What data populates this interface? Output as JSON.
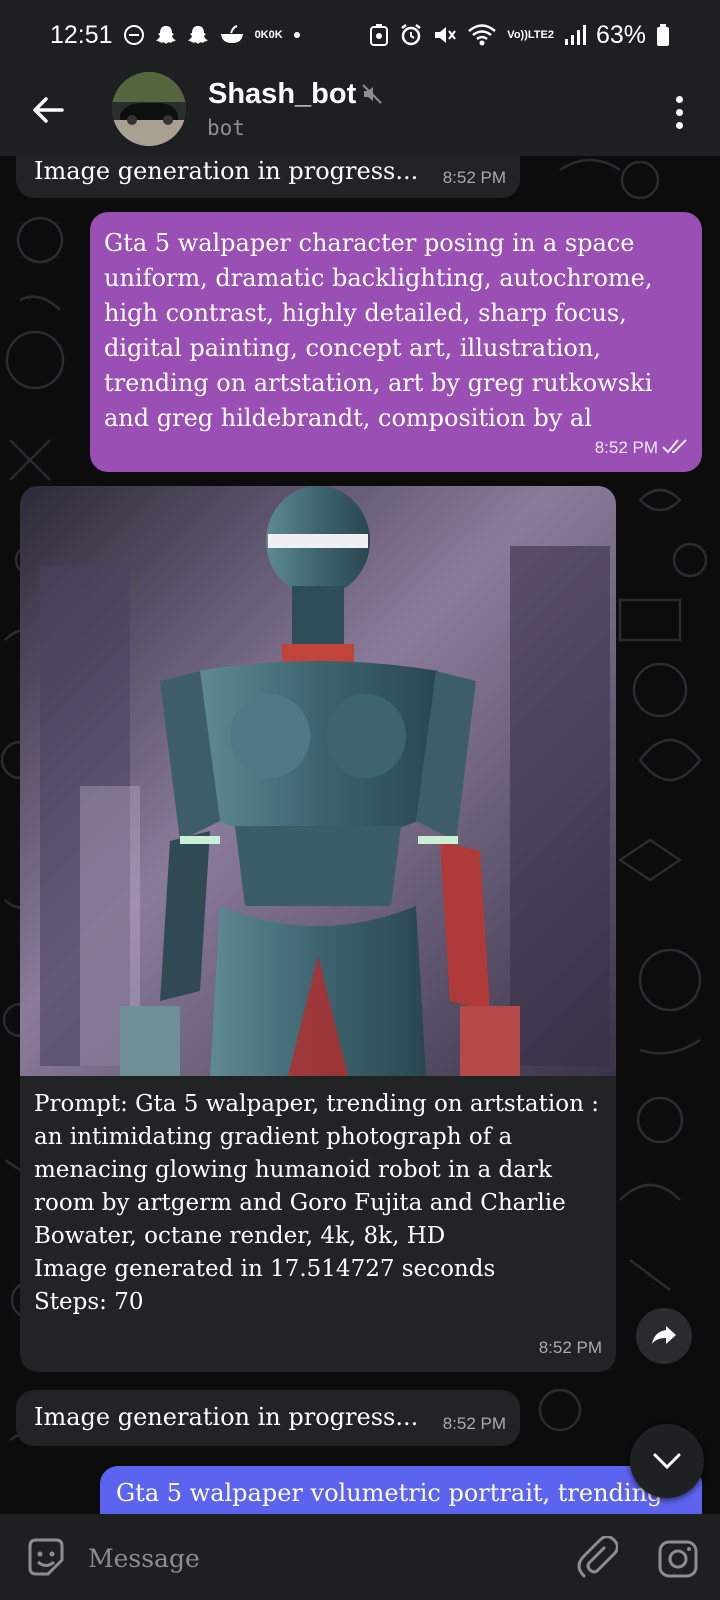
{
  "status_bar": {
    "time": "12:51",
    "data_speed_top": "0K",
    "data_speed_bottom": "0K",
    "network_label_top": "Vo))",
    "network_label_bottom": "LTE2",
    "battery_percent": "63%"
  },
  "header": {
    "title": "Shash_bot",
    "subtitle": "bot"
  },
  "messages": [
    {
      "text": "Image generation in progress...",
      "time": "8:52 PM"
    },
    {
      "text": "Gta 5 walpaper character posing in a space uniform, dramatic backlighting, autochrome, high contrast, highly detailed, sharp focus, digital painting, concept art, illustration, trending on artstation, art by greg rutkowski and greg hildebrandt, composition by al",
      "time": "8:52 PM"
    },
    {
      "text": "Prompt: Gta 5 walpaper, trending on artstation : an intimidating gradient photograph of a menacing glowing humanoid robot in a dark room by artgerm and Goro Fujita and Charlie Bowater, octane render, 4k, 8k, HD\nImage generated in 17.514727 seconds\nSteps: 70",
      "time": "8:52 PM"
    },
    {
      "text": "Image generation in progress...",
      "time": "8:52 PM"
    },
    {
      "text": "Gta 5 walpaper volumetric portrait, trending"
    }
  ],
  "input": {
    "placeholder": "Message"
  },
  "colors": {
    "outgoing_bubble": "#9a4fb5",
    "pending_bubble": "#5c63ee",
    "incoming_bubble": "#222325",
    "header_bg": "#1e1f21"
  }
}
